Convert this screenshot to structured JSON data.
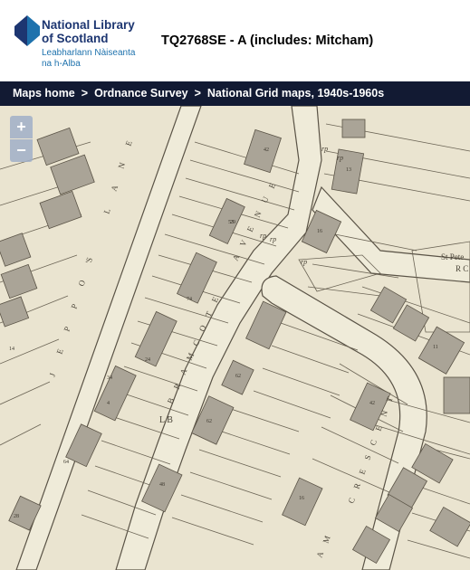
{
  "logo": {
    "name_line1": "National Library",
    "name_line2": "of Scotland",
    "gaelic_line1": "Leabharlann Nàiseanta",
    "gaelic_line2": "na h-Alba"
  },
  "page_title": "TQ2768SE - A (includes: Mitcham)",
  "breadcrumb": {
    "items": [
      "Maps home",
      "Ordnance Survey",
      "National Grid maps, 1940s-1960s"
    ],
    "separator": ">"
  },
  "zoom": {
    "in_label": "+",
    "out_label": "−"
  },
  "map": {
    "streets": [
      "JEPPO'S LANE",
      "BRAMCOTE AVENUE",
      "AM CRESCENT"
    ],
    "street_words": {
      "jeppos": [
        "J",
        "E",
        "P",
        "P",
        "O",
        "'S",
        "L",
        "A",
        "N",
        "E"
      ],
      "bramcote": [
        "B",
        "R",
        "A",
        "M",
        "C",
        "O",
        "T",
        "E",
        "A",
        "V",
        "E",
        "N",
        "U",
        "E"
      ],
      "crescent": [
        "A",
        "M",
        "C",
        "R",
        "E",
        "S",
        "C",
        "E",
        "N",
        "T"
      ]
    },
    "labels": {
      "church_line1": "St Pete",
      "church_line2": "R C",
      "lb": "L B",
      "rp1": "rp",
      "rp2": "rp",
      "rp3": "rp",
      "rp4": "rp",
      "rp5": "rp"
    },
    "house_numbers": [
      "42",
      "29",
      "74",
      "24",
      "34",
      "64",
      "62",
      "62",
      "42",
      "28",
      "48",
      "11",
      "16",
      "13",
      "16",
      "14",
      "4",
      "53"
    ],
    "colors": {
      "paper": "#eae4d0",
      "ink": "#5a5346",
      "building": "#aaa497",
      "road_fill": "#efebd9"
    }
  }
}
